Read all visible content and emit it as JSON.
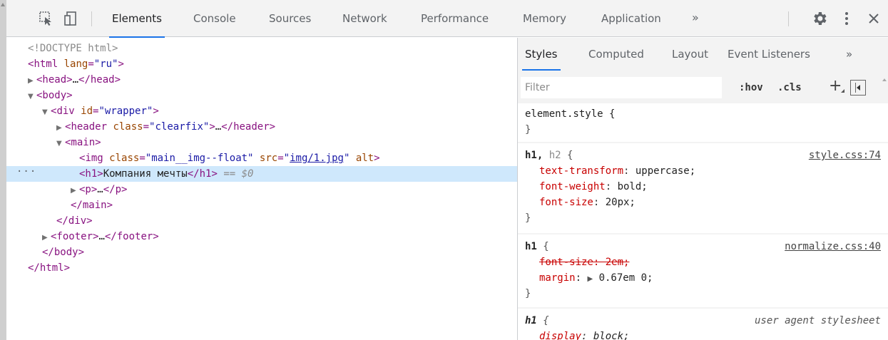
{
  "toolbar": {
    "tabs": [
      "Elements",
      "Console",
      "Sources",
      "Network",
      "Performance",
      "Memory",
      "Application"
    ],
    "more": "»"
  },
  "dom": {
    "doctype": "<!DOCTYPE html>",
    "html_tag": "html",
    "html_attr": "lang",
    "html_attr_val": "\"ru\"",
    "head_open": "<head>",
    "head_ellipsis": "…",
    "head_close": "</head>",
    "body_open": "<body>",
    "div_tag": "div",
    "div_attr": "id",
    "div_attr_val": "\"wrapper\"",
    "header_tag": "header",
    "header_attr": "class",
    "header_attr_val": "\"clearfix\"",
    "header_ellipsis": "…",
    "header_close": "</header>",
    "main_open": "<main>",
    "img_tag": "img",
    "img_class_attr": "class",
    "img_class_val": "\"main__img--float\"",
    "img_src_attr": "src",
    "img_src_val": "img/1.jpg",
    "img_alt_attr": "alt",
    "h1_open": "<h1>",
    "h1_text": "Компания мечты",
    "h1_close": "</h1>",
    "dollar": "== $0",
    "p_open": "<p>",
    "p_ellipsis": "…",
    "p_close": "</p>",
    "main_close": "</main>",
    "div_close": "</div>",
    "footer_open": "<footer>",
    "footer_ellipsis": "…",
    "footer_close": "</footer>",
    "body_close": "</body>",
    "html_close": "</html>",
    "selected_marker": "···"
  },
  "styles": {
    "subtabs": [
      "Styles",
      "Computed",
      "Layout",
      "Event Listeners"
    ],
    "more": "»",
    "filter_placeholder": "Filter",
    "hov": ":hov",
    "cls": ".cls",
    "plus": "+",
    "rules": {
      "element_style": {
        "selector": "element.style {",
        "close": "}"
      },
      "h1h2": {
        "selector_h1": "h1,",
        "selector_h2": "h2",
        "open": "{",
        "source": "style.css:74",
        "props": [
          {
            "name": "text-transform",
            "value": "uppercase;"
          },
          {
            "name": "font-weight",
            "value": "bold;"
          },
          {
            "name": "font-size",
            "value": "20px;"
          }
        ],
        "close": "}"
      },
      "h1_normalize": {
        "selector": "h1",
        "open": "{",
        "source": "normalize.css:40",
        "prop1": "font-size: 2em;",
        "prop2_name": "margin",
        "prop2_value": "0.67em 0;",
        "close": "}"
      },
      "h1_ua": {
        "selector": "h1",
        "open": "{",
        "source": "user agent stylesheet",
        "prop_name": "display",
        "prop_value": "block;"
      }
    }
  }
}
